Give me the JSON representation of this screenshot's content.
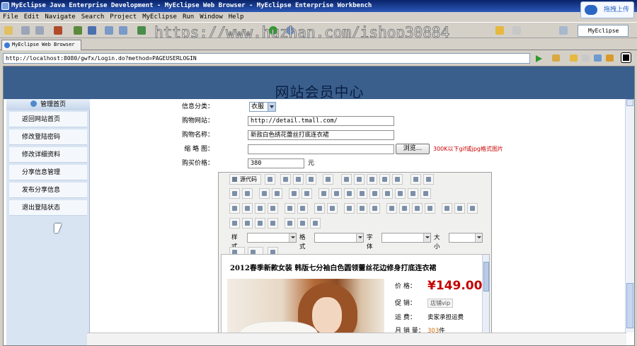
{
  "window": {
    "title": "MyEclipse Java Enterprise Development - MyEclipse Web Browser - MyEclipse Enterprise Workbench",
    "upload_label": "拖拽上传"
  },
  "menu": [
    "File",
    "Edit",
    "Navigate",
    "Search",
    "Project",
    "MyEclipse",
    "Run",
    "Window",
    "Help"
  ],
  "toolbar": {
    "perspective_label": "MyEclipse ..."
  },
  "watermark": "https://www.huzhan.com/ishop30884",
  "tab": {
    "label": "MyEclipse Web Browser"
  },
  "address": {
    "url": "http://localhost:8080/gwfx/Login.do?method=PAGEUSERLOGIN"
  },
  "site": {
    "title": "网站会员中心",
    "sidebar_header": "管理首页",
    "sidebar_items": [
      "返回网站首页",
      "修改登陆密码",
      "修改详细资料",
      "分享信息管理",
      "发布分享信息",
      "退出登陆状态"
    ]
  },
  "form": {
    "category_label": "信息分类：",
    "category_value": "衣服",
    "site_label": "购物网站：",
    "site_value": "http://detail.tmall.com/",
    "name_label": "购物名称：",
    "name_value": "新款白色绣花蕾丝打底连衣裙",
    "thumb_label": "缩 略 图：",
    "browse_label": "浏览...",
    "thumb_hint": "300K以下gif或jpg格式图片",
    "price_label": "购买价格：",
    "price_value": "380",
    "price_unit": "元"
  },
  "editor": {
    "source_label": "源代码",
    "style_label": "样式",
    "format_label": "格式",
    "font_label": "字体",
    "size_label": "大小",
    "content": {
      "title": "2012春季新款女装  韩版七分袖白色圆领蕾丝花边修身打底连衣裙",
      "price_label": "价      格：",
      "price": "¥149.00",
      "promo_label": "促      销：",
      "promo_tag": "店铺vip",
      "ship_label": "运      费：",
      "ship_value": "卖家承担运费",
      "sales_label": "月 销 量：",
      "sales_value": "303",
      "sales_unit": "件"
    }
  }
}
